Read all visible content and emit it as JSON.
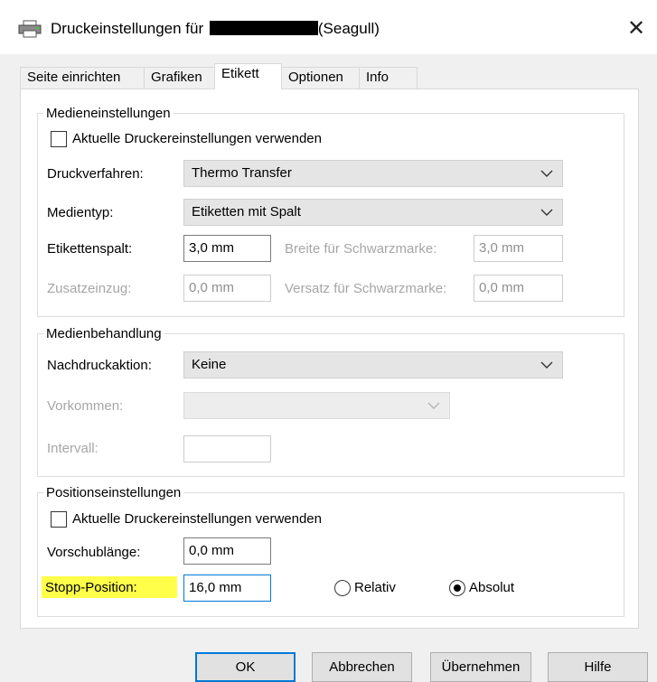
{
  "window": {
    "title_prefix": "Druckeinstellungen für",
    "title_suffix": "(Seagull)",
    "close_glyph": "✕"
  },
  "tabs": [
    {
      "label": "Seite einrichten"
    },
    {
      "label": "Grafiken"
    },
    {
      "label": "Etikett"
    },
    {
      "label": "Optionen"
    },
    {
      "label": "Info"
    }
  ],
  "media": {
    "legend": "Medieneinstellungen",
    "use_current_label": "Aktuelle Druckereinstellungen verwenden",
    "method_label": "Druckverfahren:",
    "method_value": "Thermo Transfer",
    "type_label": "Medientyp:",
    "type_value": "Etiketten mit Spalt",
    "gap_label": "Etikettenspalt:",
    "gap_value": "3,0 mm",
    "black_width_label": "Breite für Schwarzmarke:",
    "black_width_value": "3,0 mm",
    "feed_label": "Zusatzeinzug:",
    "feed_value": "0,0 mm",
    "black_offset_label": "Versatz für Schwarzmarke:",
    "black_offset_value": "0,0 mm"
  },
  "handling": {
    "legend": "Medienbehandlung",
    "post_action_label": "Nachdruckaktion:",
    "post_action_value": "Keine",
    "occurrence_label": "Vorkommen:",
    "occurrence_value": "",
    "interval_label": "Intervall:",
    "interval_value": ""
  },
  "position": {
    "legend": "Positionseinstellungen",
    "use_current_label": "Aktuelle Druckereinstellungen verwenden",
    "advance_label": "Vorschublänge:",
    "advance_value": "0,0 mm",
    "stop_label": "Stopp-Position:",
    "stop_value": "16,0 mm",
    "relative_label": "Relativ",
    "absolute_label": "Absolut",
    "selected": "Absolut"
  },
  "buttons": {
    "ok": "OK",
    "cancel": "Abbrechen",
    "apply": "Übernehmen",
    "help": "Hilfe"
  },
  "colors": {
    "highlight": "#ffff4a",
    "focus": "#0078d7"
  }
}
